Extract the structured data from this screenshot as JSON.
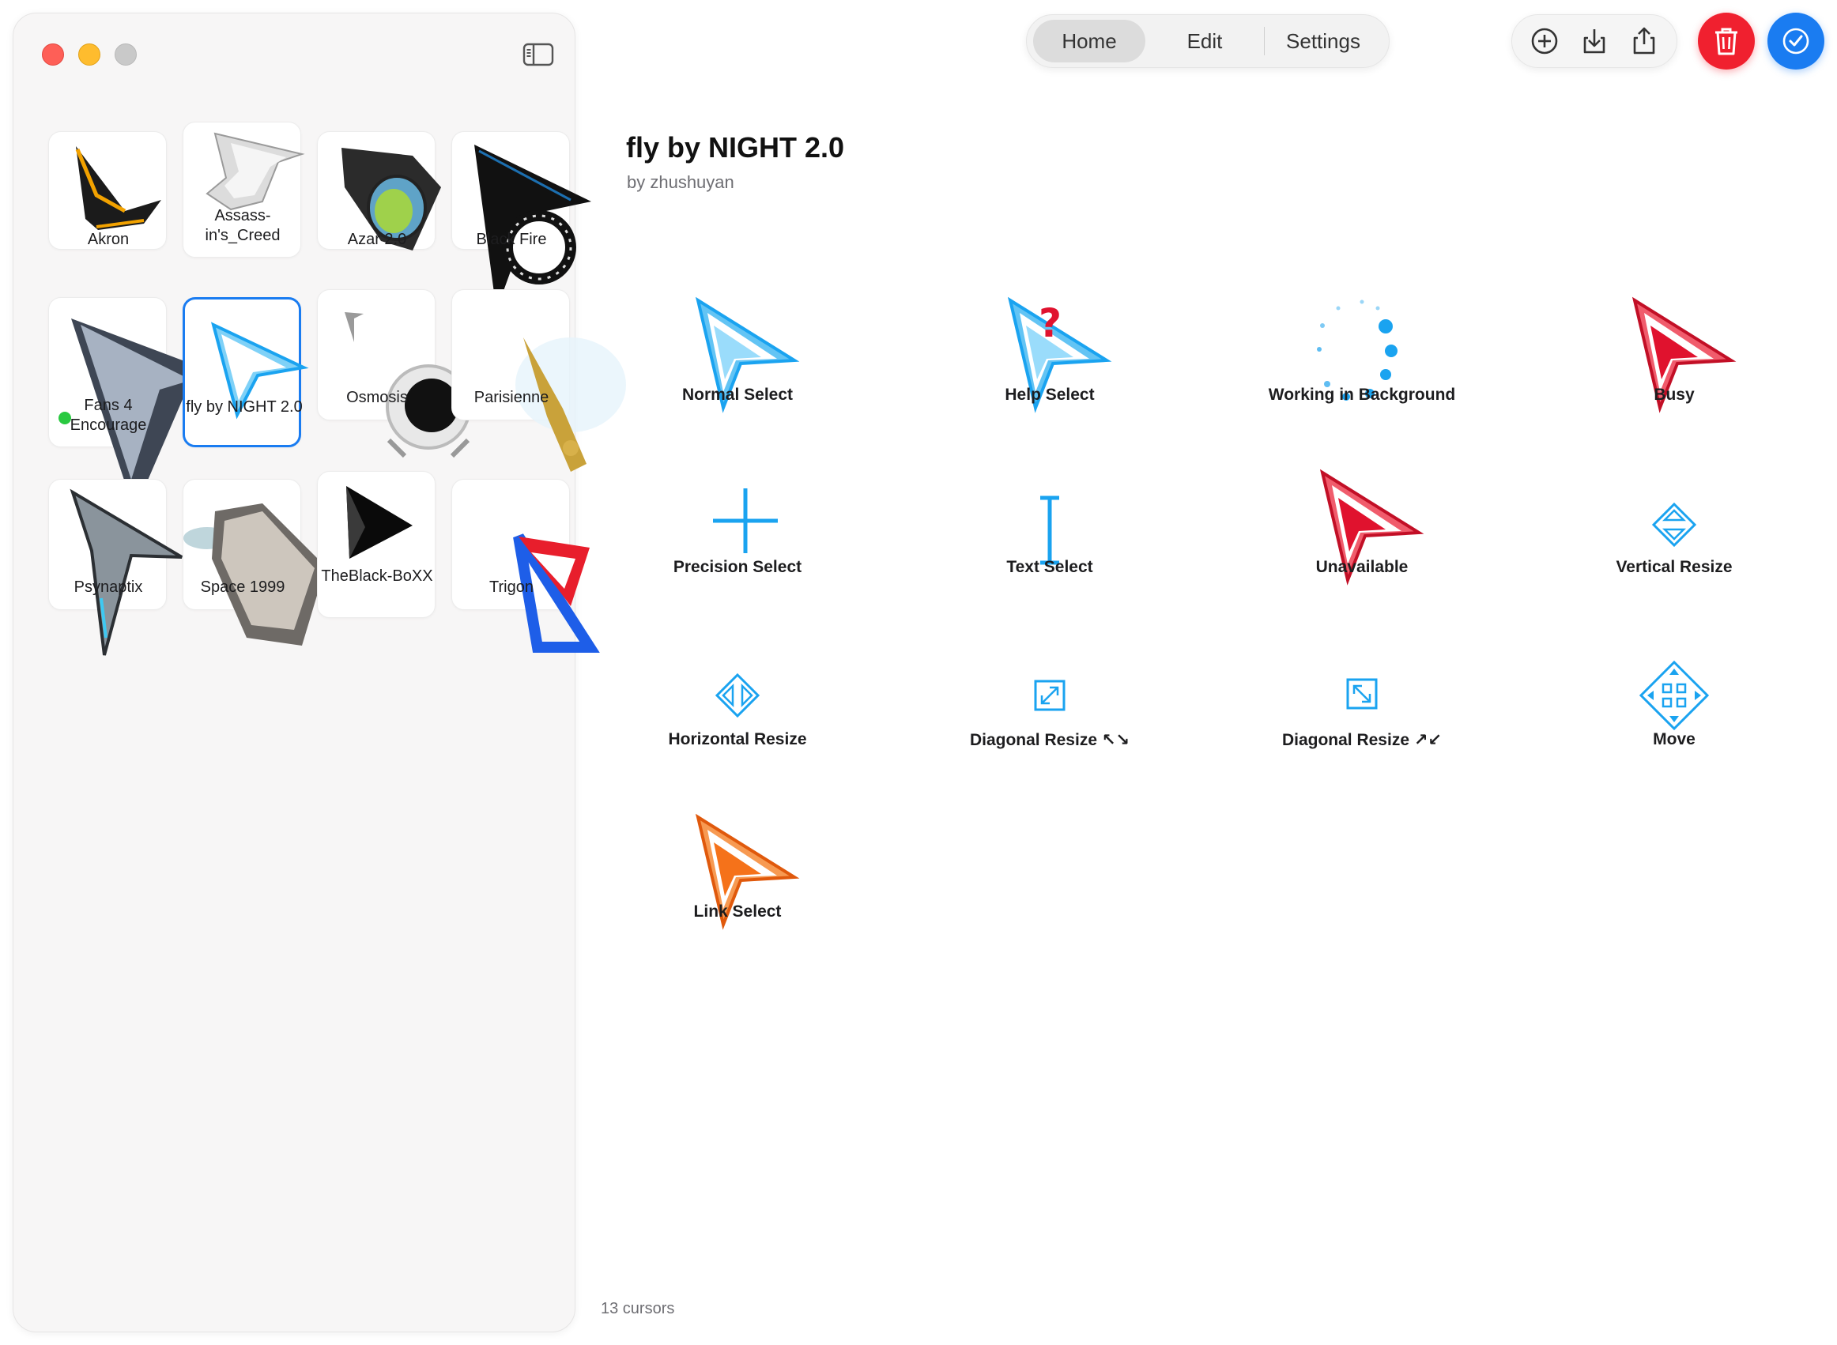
{
  "sidebar": {
    "themes": [
      {
        "label": "Akron"
      },
      {
        "label": "Assass-in's_Creed"
      },
      {
        "label": "Azar 2.0"
      },
      {
        "label": "Black Fire"
      },
      {
        "label": "Fans 4 Encourage"
      },
      {
        "label": "fly by NIGHT 2.0",
        "selected": true
      },
      {
        "label": "Osmosis"
      },
      {
        "label": "Parisienne"
      },
      {
        "label": "Psynaptix"
      },
      {
        "label": "Space 1999"
      },
      {
        "label": "TheBlack-BoXX"
      },
      {
        "label": "Trigon"
      }
    ]
  },
  "toolbar": {
    "tabs": {
      "home": "Home",
      "edit": "Edit",
      "settings": "Settings"
    },
    "active_tab": "Home",
    "icons": [
      "add-icon",
      "import-icon",
      "share-icon",
      "trash-icon",
      "checkmark-icon"
    ]
  },
  "main": {
    "title": "fly by NIGHT 2.0",
    "author": "by zhushuyan",
    "cursors": [
      {
        "label": "Normal Select",
        "icon": "arrow-cursor-icon"
      },
      {
        "label": "Help Select",
        "icon": "help-cursor-icon"
      },
      {
        "label": "Working in Background",
        "icon": "spinner-cursor-icon"
      },
      {
        "label": "Busy",
        "icon": "busy-cursor-icon"
      },
      {
        "label": "Precision Select",
        "icon": "crosshair-cursor-icon"
      },
      {
        "label": "Text Select",
        "icon": "ibeam-cursor-icon"
      },
      {
        "label": "Unavailable",
        "icon": "unavailable-cursor-icon"
      },
      {
        "label": "Vertical Resize",
        "icon": "vertical-resize-icon"
      },
      {
        "label": "Horizontal Resize",
        "icon": "horizontal-resize-icon"
      },
      {
        "label": "Diagonal Resize ↖↘",
        "icon": "diagonal-resize-nwse-icon"
      },
      {
        "label": "Diagonal Resize ↗↙",
        "icon": "diagonal-resize-nesw-icon"
      },
      {
        "label": "Move",
        "icon": "move-cursor-icon"
      },
      {
        "label": "Link Select",
        "icon": "link-cursor-icon"
      }
    ],
    "footer": "13 cursors"
  },
  "colors": {
    "accent": "#1a7cf1",
    "danger": "#f0202f",
    "cursor_blue": "#1aa3f0",
    "cursor_red": "#e0122e",
    "cursor_orange": "#f5721a"
  }
}
